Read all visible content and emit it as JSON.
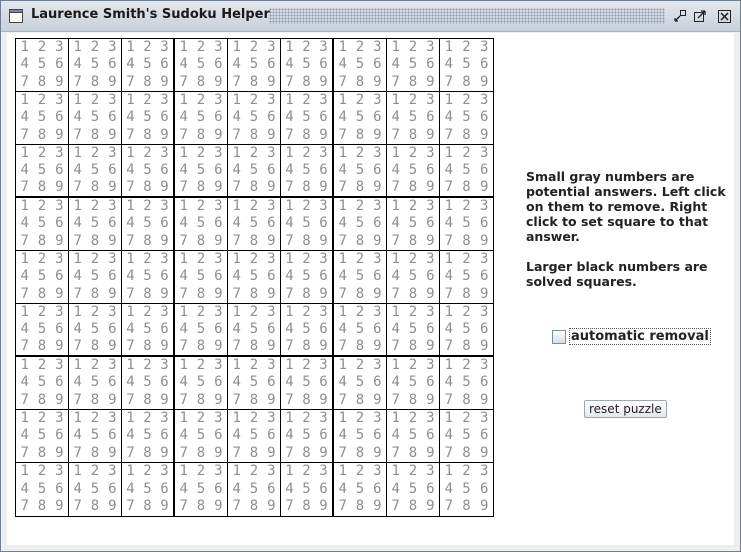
{
  "window": {
    "title": "Laurence Smith's Sudoku Helper"
  },
  "board": {
    "candidates": [
      "1",
      "2",
      "3",
      "4",
      "5",
      "6",
      "7",
      "8",
      "9"
    ],
    "cell_count": 81
  },
  "help": {
    "paragraph1": "Small gray numbers are potential answers. Left click on them to remove. Right click to set square to that answer.",
    "paragraph2": "Larger black numbers are solved squares."
  },
  "options": {
    "automatic_removal_label": "automatic removal",
    "automatic_removal_checked": false
  },
  "actions": {
    "reset_label": "reset puzzle"
  },
  "colors": {
    "candidate": "#8f8f8f",
    "grid": "#000000"
  }
}
